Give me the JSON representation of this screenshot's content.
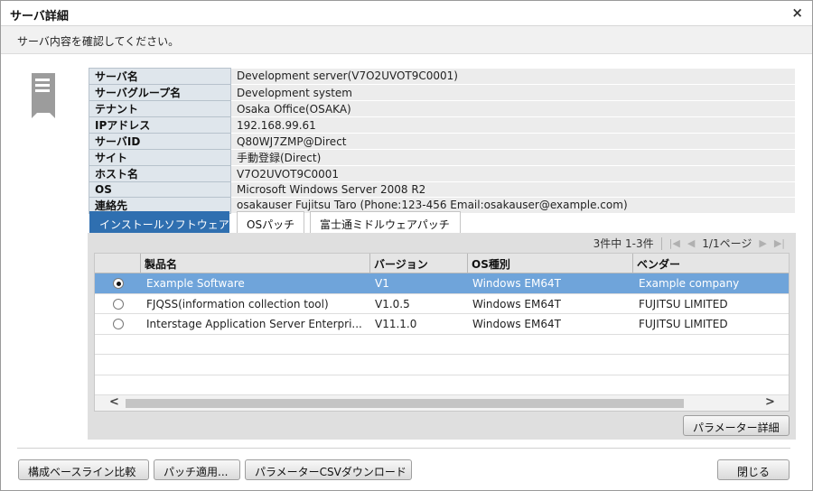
{
  "window": {
    "title": "サーバ詳細",
    "close_glyph": "×"
  },
  "subtitle": "サーバ内容を確認してください。",
  "info": [
    {
      "label": "サーバ名",
      "value": "Development server(V7O2UVOT9C0001)"
    },
    {
      "label": "サーバグループ名",
      "value": "Development system"
    },
    {
      "label": "テナント",
      "value": "Osaka Office(OSAKA)"
    },
    {
      "label": "IPアドレス",
      "value": "192.168.99.61"
    },
    {
      "label": "サーバID",
      "value": "Q80WJ7ZMP@Direct"
    },
    {
      "label": "サイト",
      "value": "手動登録(Direct)"
    },
    {
      "label": "ホスト名",
      "value": "V7O2UVOT9C0001"
    },
    {
      "label": "OS",
      "value": "Microsoft Windows Server 2008 R2"
    },
    {
      "label": "連絡先",
      "value": "osakauser  Fujitsu Taro (Phone:123-456 Email:osakauser@example.com)"
    }
  ],
  "tabs": [
    {
      "label": "インストールソフトウェア",
      "active": true
    },
    {
      "label": "OSパッチ",
      "active": false
    },
    {
      "label": "富士通ミドルウェアパッチ",
      "active": false
    }
  ],
  "pager": {
    "count": "3件中 1-3件",
    "page": "1/1ページ"
  },
  "grid": {
    "columns": [
      "製品名",
      "バージョン",
      "OS種別",
      "ベンダー"
    ],
    "rows": [
      {
        "name": "Example Software",
        "version": "V1",
        "os": "Windows EM64T",
        "vendor": "Example company",
        "selected": true
      },
      {
        "name": "FJQSS(information collection tool)",
        "version": "V1.0.5",
        "os": "Windows EM64T",
        "vendor": "FUJITSU LIMITED",
        "selected": false
      },
      {
        "name": "Interstage Application Server Enterpri...",
        "version": "V11.1.0",
        "os": "Windows EM64T",
        "vendor": "FUJITSU LIMITED",
        "selected": false
      }
    ]
  },
  "buttons": {
    "param_detail": "パラメーター詳細",
    "baseline": "構成ベースライン比較",
    "patch": "パッチ適用...",
    "csv": "パラメーターCSVダウンロード",
    "close": "閉じる"
  },
  "colors": {
    "accent": "#2f6fb0",
    "selected_row": "#6fa4da"
  }
}
